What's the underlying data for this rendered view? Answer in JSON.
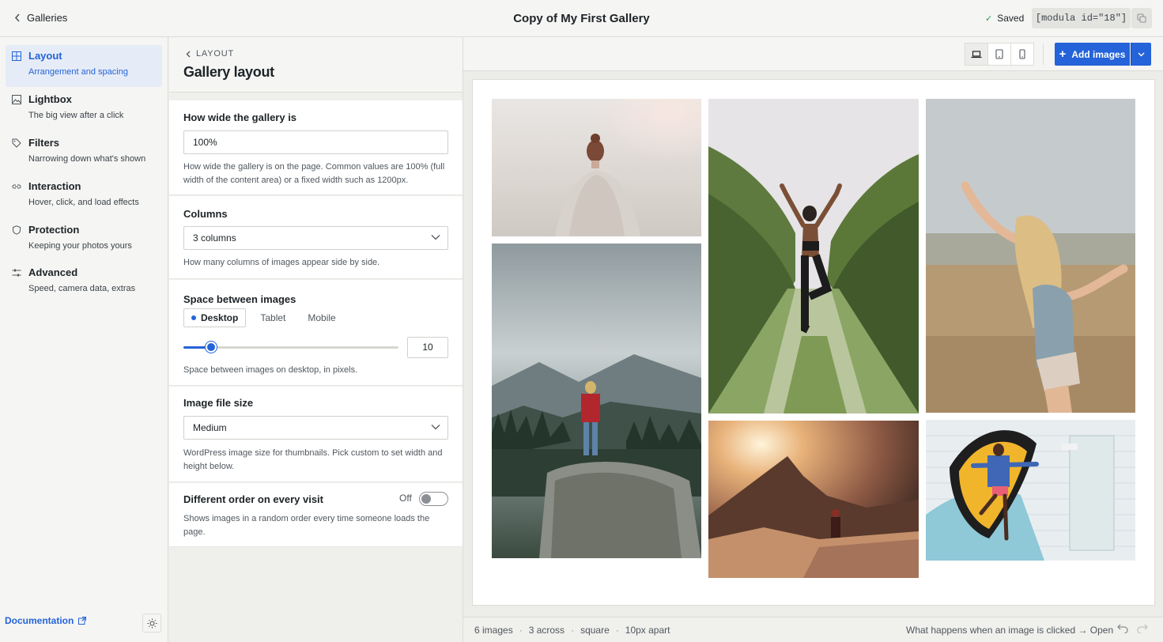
{
  "topbar": {
    "back_label": "Galleries",
    "title": "Copy of My First Gallery",
    "status": "Saved",
    "shortcode": "[modula id=\"18\"]"
  },
  "nav": {
    "items": [
      {
        "label": "Layout",
        "desc": "Arrangement and spacing",
        "icon": "grid-icon",
        "active": true
      },
      {
        "label": "Lightbox",
        "desc": "The big view after a click",
        "icon": "image-icon"
      },
      {
        "label": "Filters",
        "desc": "Narrowing down what's shown",
        "icon": "tag-icon"
      },
      {
        "label": "Interaction",
        "desc": "Hover, click, and load effects",
        "icon": "link-icon"
      },
      {
        "label": "Protection",
        "desc": "Keeping your photos yours",
        "icon": "shield-icon"
      },
      {
        "label": "Advanced",
        "desc": "Speed, camera data, extras",
        "icon": "sliders-icon"
      }
    ],
    "documentation": "Documentation"
  },
  "panel": {
    "crumb": "LAYOUT",
    "title": "Gallery layout",
    "width": {
      "label": "How wide the gallery is",
      "value": "100%",
      "help": "How wide the gallery is on the page. Common values are 100% (full width of the content area) or a fixed width such as 1200px."
    },
    "columns": {
      "label": "Columns",
      "value": "3 columns",
      "help": "How many columns of images appear side by side."
    },
    "spacing": {
      "label": "Space between images",
      "tabs": [
        "Desktop",
        "Tablet",
        "Mobile"
      ],
      "active_tab": "Desktop",
      "value": "10",
      "fraction": 0.13,
      "help": "Space between images on desktop, in pixels."
    },
    "filesize": {
      "label": "Image file size",
      "value": "Medium",
      "help": "WordPress image size for thumbnails. Pick custom to set width and height below."
    },
    "random": {
      "label": "Different order on every visit",
      "state": "Off",
      "help": "Shows images in a random order every time someone loads the page."
    }
  },
  "preview": {
    "add_label": "Add images",
    "images": [
      {
        "name": "woman-in-sweater-photo"
      },
      {
        "name": "yoga-pose-vineyard-photo"
      },
      {
        "name": "blonde-woman-arms-out-photo"
      },
      {
        "name": "hiker-on-cliff-photo"
      },
      {
        "name": "sunset-mountain-viewer-photo"
      },
      {
        "name": "mural-jump-photo"
      }
    ],
    "stats": [
      "6 images",
      "3 across",
      "square",
      "10px apart"
    ],
    "stats_sep": "·",
    "hint": "What happens when an image is clicked → Open in lightbox"
  },
  "colors": {
    "accent": "#2463d9",
    "saved": "#1f9d55"
  }
}
